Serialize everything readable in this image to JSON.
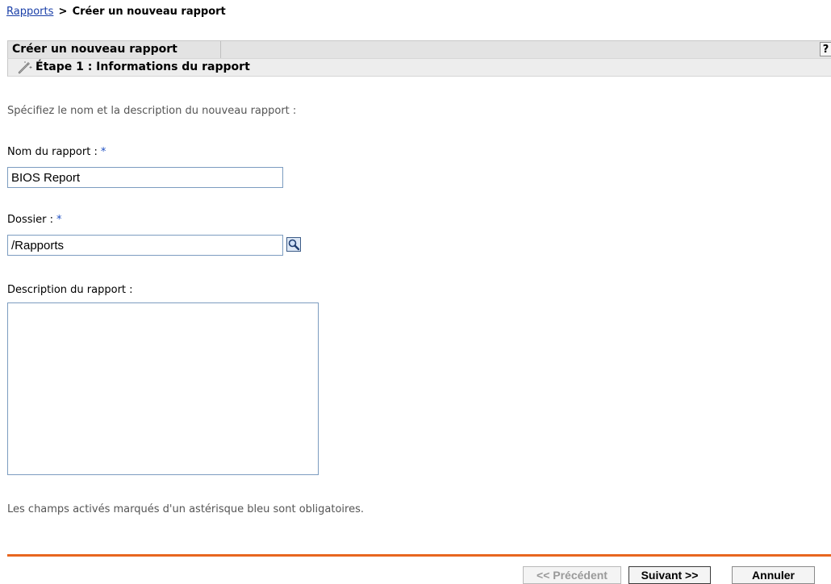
{
  "breadcrumb": {
    "link": "Rapports",
    "separator": ">",
    "current": "Créer un nouveau rapport"
  },
  "panel": {
    "title": "Créer un nouveau rapport",
    "help_label": "?",
    "step_title": "Étape 1 : Informations du rapport",
    "step_icon": "wand-icon"
  },
  "form": {
    "intro": "Spécifiez le nom et la description du nouveau rapport :",
    "name_label": "Nom du rapport :",
    "name_value": "BIOS Report",
    "folder_label": "Dossier :",
    "folder_value": "/Rapports",
    "folder_browse_icon": "search-icon",
    "description_label": "Description du rapport :",
    "description_value": "",
    "required_marker": "*",
    "required_note": "Les champs activés marqués d'un astérisque bleu sont obligatoires."
  },
  "buttons": {
    "previous": "<< Précédent",
    "next": "Suivant >>",
    "cancel": "Annuler"
  },
  "colors": {
    "accent_divider": "#e8661f",
    "required_asterisk": "#1e4fc2",
    "link": "#1a3fa8"
  }
}
